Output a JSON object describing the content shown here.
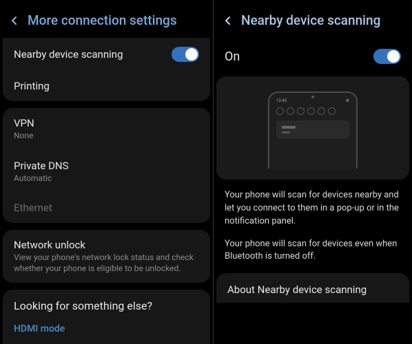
{
  "left": {
    "header_title": "More connection settings",
    "group1": {
      "nearby": {
        "label": "Nearby device scanning",
        "enabled": true
      },
      "printing": {
        "label": "Printing"
      }
    },
    "group2": {
      "vpn": {
        "label": "VPN",
        "value": "None"
      },
      "dns": {
        "label": "Private DNS",
        "value": "Automatic"
      },
      "ethernet": {
        "label": "Ethernet"
      }
    },
    "group3": {
      "netunlock": {
        "label": "Network unlock",
        "desc": "View your phone's network lock status and check whether your phone is eligible to be unlocked."
      }
    },
    "looking": "Looking for something else?",
    "hdmi": "HDMI mode"
  },
  "right": {
    "header_title": "Nearby device scanning",
    "on_label": "On",
    "enabled": true,
    "phone_time": "12:45",
    "desc1": "Your phone will scan for devices nearby and let you connect to them in a pop-up or in the notification panel.",
    "desc2": "Your phone will scan for devices even when Bluetooth is turned off.",
    "about": "About Nearby device scanning"
  }
}
